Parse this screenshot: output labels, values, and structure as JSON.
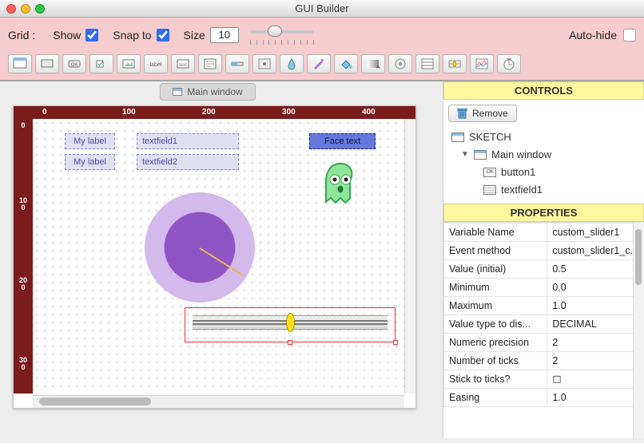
{
  "window": {
    "title": "GUI Builder"
  },
  "toolbar": {
    "grid_label": "Grid :",
    "show_label": "Show",
    "show_checked": true,
    "snap_label": "Snap to",
    "snap_checked": true,
    "size_label": "Size",
    "size_value": "10",
    "autohide_label": "Auto-hide",
    "autohide_checked": false,
    "tool_icons": [
      "window",
      "panel",
      "ok-button",
      "checkbox",
      "imgbutton",
      "label",
      "text",
      "textarea",
      "slider",
      "slider2d",
      "drop",
      "accent",
      "fill",
      "gradient",
      "knob",
      "option",
      "customslider",
      "timer",
      "sketch"
    ]
  },
  "canvas": {
    "chip_label": "Main window",
    "ruler_top": [
      "0",
      "100",
      "200",
      "300",
      "400"
    ],
    "ruler_left": [
      "0",
      "100",
      "200",
      "300"
    ],
    "label1": "My label",
    "label2": "My label",
    "textfield1": "textfield1",
    "textfield2": "textfield2",
    "button1": "Face text"
  },
  "controls_panel": {
    "title": "CONTROLS",
    "remove_label": "Remove",
    "tree": {
      "root": "SKETCH",
      "window": "Main window",
      "child_button": "button1",
      "child_text": "textfield1"
    }
  },
  "properties_panel": {
    "title": "PROPERTIES",
    "rows": [
      {
        "k": "Variable Name",
        "v": "custom_slider1"
      },
      {
        "k": "Event method",
        "v": "custom_slider1_c..."
      },
      {
        "k": "Value (initial)",
        "v": "0.5"
      },
      {
        "k": "Minimum",
        "v": "0.0"
      },
      {
        "k": "Maximum",
        "v": "1.0"
      },
      {
        "k": "Value type to dis...",
        "v": "DECIMAL"
      },
      {
        "k": "Numeric precision",
        "v": "2"
      },
      {
        "k": "Number of ticks",
        "v": "2"
      },
      {
        "k": "Stick to ticks?",
        "v": "☐"
      },
      {
        "k": "Easing",
        "v": "1.0"
      }
    ]
  }
}
